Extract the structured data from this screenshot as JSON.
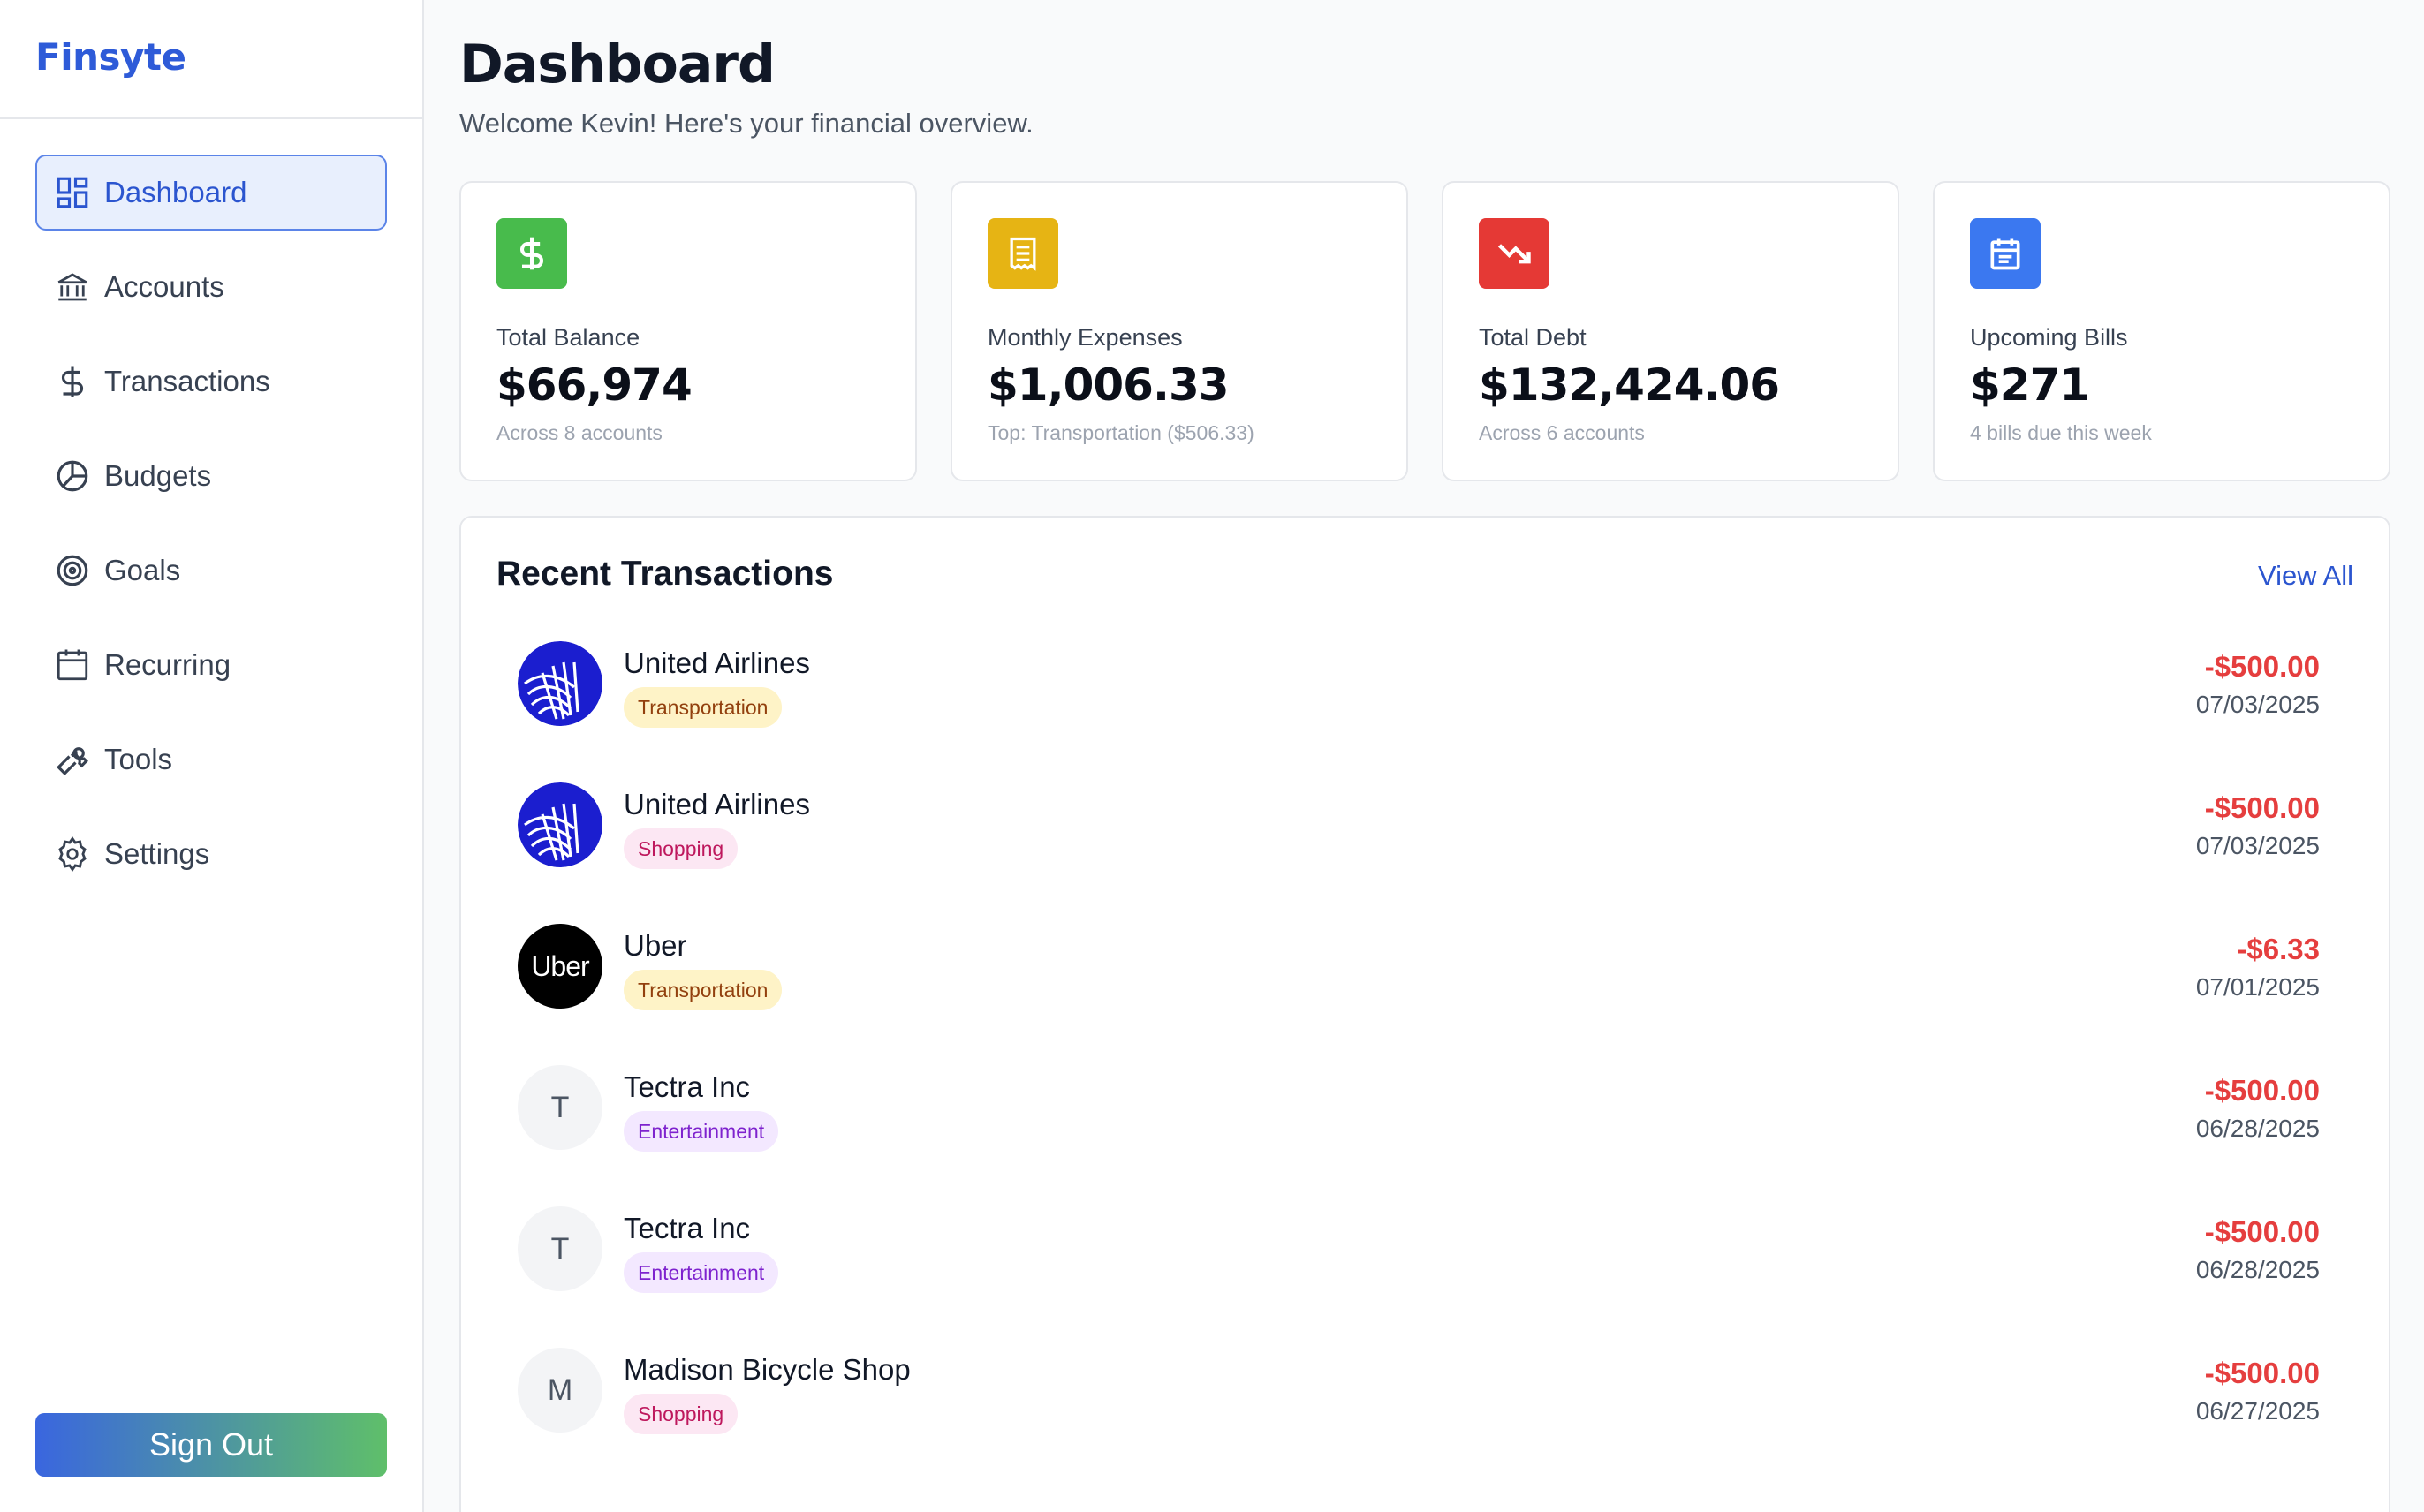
{
  "brand": "Finsyte",
  "nav": [
    {
      "label": "Dashboard",
      "icon": "dashboard-icon",
      "active": true
    },
    {
      "label": "Accounts",
      "icon": "bank-icon"
    },
    {
      "label": "Transactions",
      "icon": "dollar-icon"
    },
    {
      "label": "Budgets",
      "icon": "pie-chart-icon"
    },
    {
      "label": "Goals",
      "icon": "target-icon"
    },
    {
      "label": "Recurring",
      "icon": "calendar-icon"
    },
    {
      "label": "Tools",
      "icon": "wrench-icon"
    },
    {
      "label": "Settings",
      "icon": "gear-icon"
    }
  ],
  "sign_out_label": "Sign Out",
  "header": {
    "title": "Dashboard",
    "subtitle": "Welcome Kevin! Here's your financial overview."
  },
  "cards": [
    {
      "label": "Total Balance",
      "value": "$66,974",
      "note": "Across 8 accounts",
      "icon": "dollar-icon",
      "color": "#48bb4c"
    },
    {
      "label": "Monthly Expenses",
      "value": "$1,006.33",
      "note": "Top: Transportation ($506.33)",
      "icon": "receipt-icon",
      "color": "#e6b414"
    },
    {
      "label": "Total Debt",
      "value": "$132,424.06",
      "note": "Across 6 accounts",
      "icon": "trending-down-icon",
      "color": "#e53935"
    },
    {
      "label": "Upcoming Bills",
      "value": "$271",
      "note": "4 bills due this week",
      "icon": "calendar-icon",
      "color": "#3b78f0"
    }
  ],
  "transactions": {
    "title": "Recent Transactions",
    "view_all": "View All",
    "items": [
      {
        "name": "United Airlines",
        "category": "Transportation",
        "amount": "-$500.00",
        "date": "07/03/2025",
        "avatar": "united-airlines-logo"
      },
      {
        "name": "United Airlines",
        "category": "Shopping",
        "amount": "-$500.00",
        "date": "07/03/2025",
        "avatar": "united-airlines-logo"
      },
      {
        "name": "Uber",
        "category": "Transportation",
        "amount": "-$6.33",
        "date": "07/01/2025",
        "avatar": "uber-logo",
        "avatar_text": "Uber"
      },
      {
        "name": "Tectra Inc",
        "category": "Entertainment",
        "amount": "-$500.00",
        "date": "06/28/2025",
        "avatar": "initial",
        "avatar_text": "T"
      },
      {
        "name": "Tectra Inc",
        "category": "Entertainment",
        "amount": "-$500.00",
        "date": "06/28/2025",
        "avatar": "initial",
        "avatar_text": "T"
      },
      {
        "name": "Madison Bicycle Shop",
        "category": "Shopping",
        "amount": "-$500.00",
        "date": "06/27/2025",
        "avatar": "initial",
        "avatar_text": "M"
      }
    ]
  },
  "colors": {
    "brand": "#2e5bd8",
    "negative_amount": "#e53e3e",
    "active_nav_bg": "#e8effd"
  }
}
